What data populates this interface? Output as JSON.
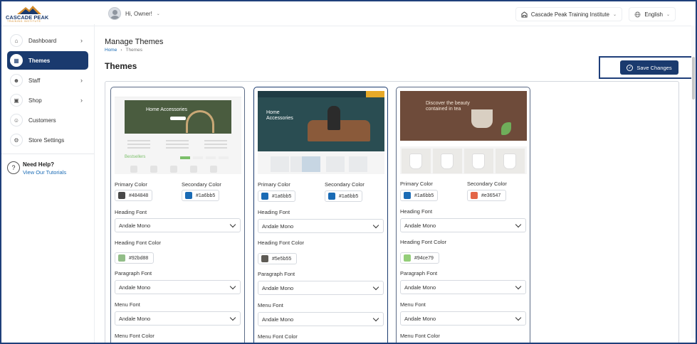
{
  "logo": {
    "name": "CASCADE PEAK",
    "tagline": "TRAINING INSTITUTE"
  },
  "topbar": {
    "greeting": "Hi, Owner!",
    "organization": "Cascade Peak Training Institute",
    "language": "English"
  },
  "sidebar": {
    "items": [
      {
        "label": "Dashboard",
        "icon": "home-icon",
        "has_arrow": true,
        "active": false
      },
      {
        "label": "Themes",
        "icon": "themes-icon",
        "has_arrow": false,
        "active": true
      },
      {
        "label": "Staff",
        "icon": "users-icon",
        "has_arrow": true,
        "active": false
      },
      {
        "label": "Shop",
        "icon": "shop-icon",
        "has_arrow": true,
        "active": false
      },
      {
        "label": "Customers",
        "icon": "user-icon",
        "has_arrow": false,
        "active": false
      },
      {
        "label": "Store Settings",
        "icon": "gear-icon",
        "has_arrow": false,
        "active": false
      }
    ],
    "help": {
      "title": "Need Help?",
      "link": "View Our Tutorials"
    }
  },
  "header": {
    "page_title": "Manage Themes",
    "breadcrumb": [
      "Home",
      "Themes"
    ],
    "section_title": "Themes",
    "save_label": "Save Changes"
  },
  "labels": {
    "primary_color": "Primary Color",
    "secondary_color": "Secondary Color",
    "heading_font": "Heading Font",
    "heading_font_color": "Heading Font Color",
    "paragraph_font": "Paragraph Font",
    "menu_font": "Menu Font",
    "menu_font_color": "Menu Font Color"
  },
  "themes": [
    {
      "preview_heading": "Home Accessories",
      "preview_section": "Bestsellers",
      "primary_color": "#484848",
      "secondary_color": "#1a6bb5",
      "heading_font": "Andale Mono",
      "heading_font_color": "#92bd88",
      "paragraph_font": "Andale Mono",
      "menu_font": "Andale Mono",
      "selected": false
    },
    {
      "preview_heading_line1": "Home",
      "preview_heading_line2": "Accessories",
      "primary_color": "#1a6bb5",
      "secondary_color": "#1a6bb5",
      "heading_font": "Andale Mono",
      "heading_font_color": "#5e5b55",
      "paragraph_font": "Andale Mono",
      "menu_font": "Andale Mono",
      "selected": true
    },
    {
      "preview_heading_line1": "Discover the beauty",
      "preview_heading_line2": "contained in tea",
      "primary_color": "#1a6bb5",
      "secondary_color": "#e36547",
      "heading_font": "Andale Mono",
      "heading_font_color": "#94ce79",
      "paragraph_font": "Andale Mono",
      "menu_font": "Andale Mono",
      "selected": false
    }
  ]
}
